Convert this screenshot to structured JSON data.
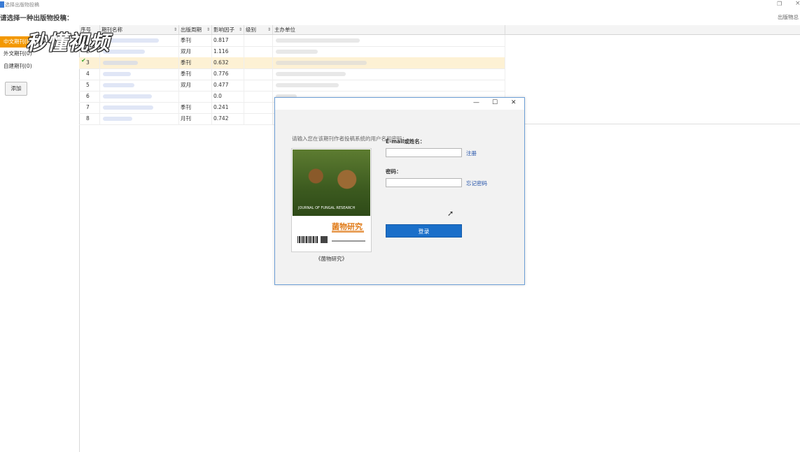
{
  "window": {
    "title": "选择出版物投稿",
    "restore_glyph": "❐",
    "close_glyph": "×"
  },
  "header": {
    "prompt": "请选择一种出版物投稿：",
    "right_text": "出版物总"
  },
  "sidebar": {
    "categories": [
      {
        "label": "中文期刊(8)",
        "active": true
      },
      {
        "label": "外文期刊(0)",
        "active": false
      },
      {
        "label": "自建期刊(0)",
        "active": false
      }
    ],
    "add_label": "添加"
  },
  "table": {
    "columns": [
      "序号",
      "期刊名称",
      "出版周期",
      "影响因子",
      "级别",
      "主办单位"
    ],
    "sort_glyph": "⇕",
    "rows": [
      {
        "no": "1",
        "cycle": "季刊",
        "impact": "0.817",
        "selected": false
      },
      {
        "no": "2",
        "cycle": "双月",
        "impact": "1.116",
        "selected": false
      },
      {
        "no": "3",
        "cycle": "季刊",
        "impact": "0.632",
        "selected": true
      },
      {
        "no": "4",
        "cycle": "季刊",
        "impact": "0.776",
        "selected": false
      },
      {
        "no": "5",
        "cycle": "双月",
        "impact": "0.477",
        "selected": false
      },
      {
        "no": "6",
        "cycle": "",
        "impact": "0.0",
        "selected": false
      },
      {
        "no": "7",
        "cycle": "季刊",
        "impact": "0.241",
        "selected": false
      },
      {
        "no": "8",
        "cycle": "月刊",
        "impact": "0.742",
        "selected": false
      }
    ],
    "check_glyph": "✔"
  },
  "watermark": {
    "text": "秒懂视频"
  },
  "dialog": {
    "minimize_glyph": "—",
    "maximize_glyph": "☐",
    "close_glyph": "✕",
    "instruction": "请输入您在该期刊作者投稿系统的用户名和密码：",
    "cover": {
      "journal_en": "JOURNAL OF FUNGAL RESEARCH",
      "journal_cn": "菌物研究"
    },
    "caption": "《菌物研究》",
    "email_label": "E-mail或姓名：",
    "email_value": "",
    "register_link": "注册",
    "password_label": "密码：",
    "password_value": "",
    "forgot_link": "忘记密码",
    "login_label": "登录"
  }
}
